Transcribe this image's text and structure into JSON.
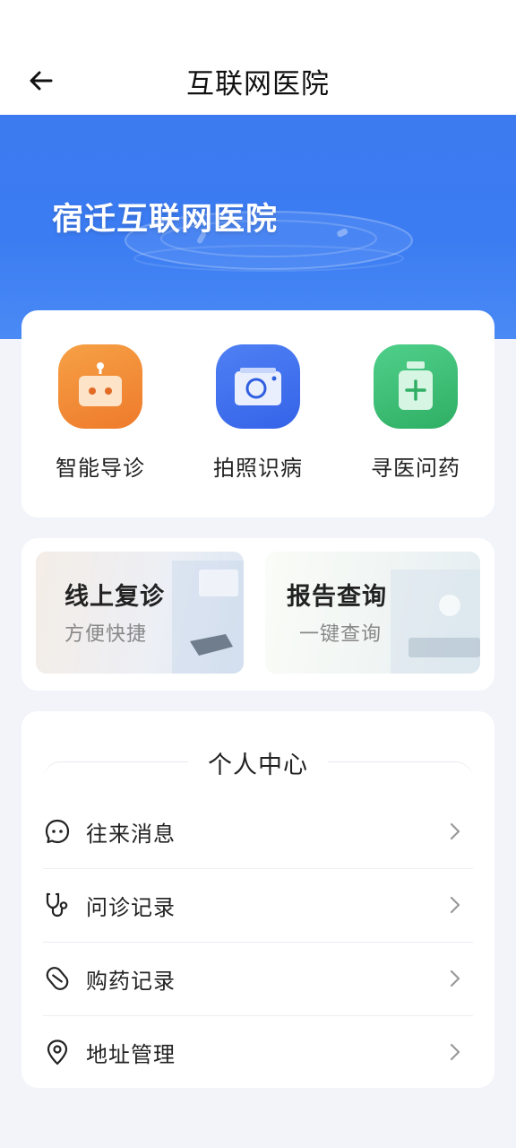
{
  "header": {
    "title": "互联网医院"
  },
  "hero": {
    "title": "宿迁互联网医院"
  },
  "functions": [
    {
      "label": "智能导诊",
      "icon": "robot-icon",
      "color": "#f08a33"
    },
    {
      "label": "拍照识病",
      "icon": "camera-icon",
      "color": "#3f6ff0"
    },
    {
      "label": "寻医问药",
      "icon": "medicine-bottle-icon",
      "color": "#3ec47a"
    }
  ],
  "services": [
    {
      "title": "线上复诊",
      "subtitle": "方便快捷"
    },
    {
      "title": "报告查询",
      "subtitle": "一键查询"
    }
  ],
  "personal": {
    "title": "个人中心",
    "items": [
      {
        "label": "往来消息",
        "icon": "message-icon"
      },
      {
        "label": "问诊记录",
        "icon": "stethoscope-icon"
      },
      {
        "label": "购药记录",
        "icon": "pill-icon"
      },
      {
        "label": "地址管理",
        "icon": "location-pin-icon"
      }
    ]
  },
  "colors": {
    "primary": "#3b7cf2",
    "background": "#f2f4f9"
  }
}
